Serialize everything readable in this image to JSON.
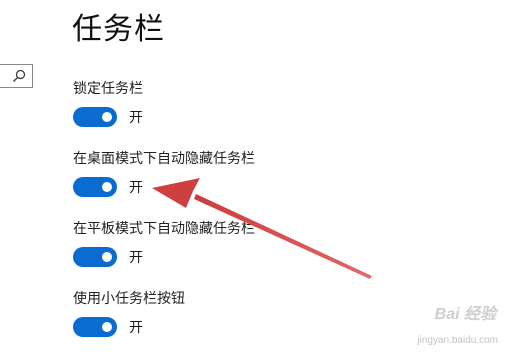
{
  "header": {
    "title": "任务栏"
  },
  "search": {
    "icon": "search-icon"
  },
  "settings": [
    {
      "label": "锁定任务栏",
      "state": "开",
      "on": true
    },
    {
      "label": "在桌面模式下自动隐藏任务栏",
      "state": "开",
      "on": true
    },
    {
      "label": "在平板模式下自动隐藏任务栏",
      "state": "开",
      "on": true
    },
    {
      "label": "使用小任务栏按钮",
      "state": "开",
      "on": true
    }
  ],
  "annotation": {
    "arrow_color": "#d94a4a",
    "points_to": "在桌面模式下自动隐藏任务栏"
  },
  "watermark": {
    "text": "Bai 经验",
    "sub": "jingyan.baidu.com"
  },
  "colors": {
    "toggle_on": "#0a6cd1",
    "background": "#ffffff"
  }
}
